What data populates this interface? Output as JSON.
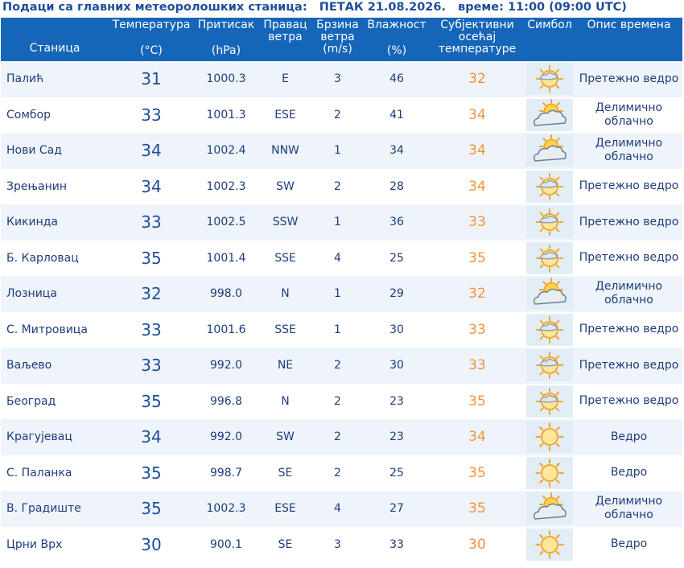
{
  "title": {
    "prefix": "Подаци са главних метеоролошких станица:",
    "date": "ПЕТАК 21.08.2026.",
    "time": "време: 11:00 (09:00 UTC)"
  },
  "headers": {
    "station": "Станица",
    "temp_top": "Температура",
    "temp_unit": "(°C)",
    "pressure_top": "Притисак",
    "pressure_unit": "(hPa)",
    "wind_dir": "Правац ветра",
    "wind_speed_top": "Брзина ветра",
    "wind_speed_unit": "(m/s)",
    "humidity_top": "Влажност",
    "humidity_unit": "(%)",
    "feel": "Субјективни осећај температуре",
    "symbol": "Симбол",
    "desc": "Опис времена"
  },
  "colors": {
    "header_bg": "#1565b8",
    "title_text": "#1f4e9c",
    "feel_text": "#f3923a",
    "row_alt_bg": "#eef4fa"
  },
  "rows": [
    {
      "station": "Палић",
      "temp": "31",
      "pressure": "1000.3",
      "wind_dir": "E",
      "wind_speed": "3",
      "humidity": "46",
      "feel": "32",
      "symbol": "sun-behind-cloud-icon",
      "desc": "Претежно ведро"
    },
    {
      "station": "Сомбор",
      "temp": "33",
      "pressure": "1001.3",
      "wind_dir": "ESE",
      "wind_speed": "2",
      "humidity": "41",
      "feel": "34",
      "symbol": "partly-cloudy-icon",
      "desc": "Делимично облачно"
    },
    {
      "station": "Нови Сад",
      "temp": "34",
      "pressure": "1002.4",
      "wind_dir": "NNW",
      "wind_speed": "1",
      "humidity": "34",
      "feel": "34",
      "symbol": "partly-cloudy-icon",
      "desc": "Делимично облачно"
    },
    {
      "station": "Зрењанин",
      "temp": "34",
      "pressure": "1002.3",
      "wind_dir": "SW",
      "wind_speed": "2",
      "humidity": "28",
      "feel": "34",
      "symbol": "sun-behind-cloud-icon",
      "desc": "Претежно ведро"
    },
    {
      "station": "Кикинда",
      "temp": "33",
      "pressure": "1002.5",
      "wind_dir": "SSW",
      "wind_speed": "1",
      "humidity": "36",
      "feel": "33",
      "symbol": "sun-behind-cloud-icon",
      "desc": "Претежно ведро"
    },
    {
      "station": "Б. Карловац",
      "temp": "35",
      "pressure": "1001.4",
      "wind_dir": "SSE",
      "wind_speed": "4",
      "humidity": "25",
      "feel": "35",
      "symbol": "sun-behind-cloud-icon",
      "desc": "Претежно ведро"
    },
    {
      "station": "Лозница",
      "temp": "32",
      "pressure": "998.0",
      "wind_dir": "N",
      "wind_speed": "1",
      "humidity": "29",
      "feel": "32",
      "symbol": "partly-cloudy-icon",
      "desc": "Делимично облачно"
    },
    {
      "station": "С. Митровица",
      "temp": "33",
      "pressure": "1001.6",
      "wind_dir": "SSE",
      "wind_speed": "1",
      "humidity": "30",
      "feel": "33",
      "symbol": "sun-behind-cloud-icon",
      "desc": "Претежно ведро"
    },
    {
      "station": "Ваљево",
      "temp": "33",
      "pressure": "992.0",
      "wind_dir": "NE",
      "wind_speed": "2",
      "humidity": "30",
      "feel": "33",
      "symbol": "sun-behind-cloud-icon",
      "desc": "Претежно ведро"
    },
    {
      "station": "Београд",
      "temp": "35",
      "pressure": "996.8",
      "wind_dir": "N",
      "wind_speed": "2",
      "humidity": "23",
      "feel": "35",
      "symbol": "sun-behind-cloud-icon",
      "desc": "Претежно ведро"
    },
    {
      "station": "Крагујевац",
      "temp": "34",
      "pressure": "992.0",
      "wind_dir": "SW",
      "wind_speed": "2",
      "humidity": "23",
      "feel": "34",
      "symbol": "sun-icon",
      "desc": "Ведро"
    },
    {
      "station": "С. Паланка",
      "temp": "35",
      "pressure": "998.7",
      "wind_dir": "SE",
      "wind_speed": "2",
      "humidity": "25",
      "feel": "35",
      "symbol": "sun-icon",
      "desc": "Ведро"
    },
    {
      "station": "В. Градиште",
      "temp": "35",
      "pressure": "1002.3",
      "wind_dir": "ESE",
      "wind_speed": "4",
      "humidity": "27",
      "feel": "35",
      "symbol": "partly-cloudy-icon",
      "desc": "Делимично облачно"
    },
    {
      "station": "Црни Врх",
      "temp": "30",
      "pressure": "900.1",
      "wind_dir": "SE",
      "wind_speed": "3",
      "humidity": "33",
      "feel": "30",
      "symbol": "sun-icon",
      "desc": "Ведро"
    }
  ]
}
